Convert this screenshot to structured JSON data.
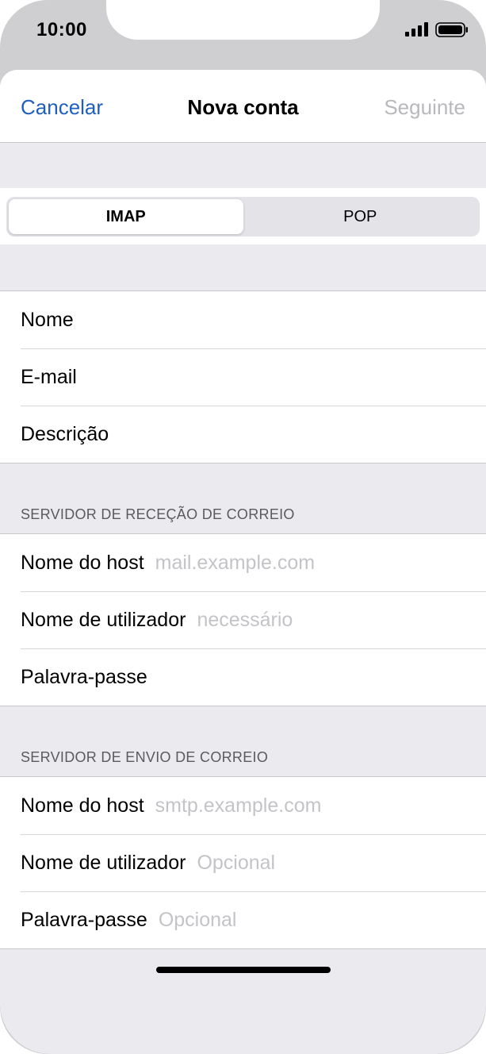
{
  "status_bar": {
    "time": "10:00",
    "signal_icon": "cellular-signal-icon",
    "battery_icon": "battery-full-icon"
  },
  "nav": {
    "cancel_label": "Cancelar",
    "title": "Nova conta",
    "next_label": "Seguinte"
  },
  "segments": [
    {
      "label": "IMAP",
      "selected": true
    },
    {
      "label": "POP",
      "selected": false
    }
  ],
  "account": {
    "name_label": "Nome",
    "email_label": "E-mail",
    "description_label": "Descrição"
  },
  "incoming": {
    "header": "SERVIDOR DE RECEÇÃO DE CORREIO",
    "host_label": "Nome do host",
    "host_placeholder": "mail.example.com",
    "user_label": "Nome de utilizador",
    "user_placeholder": "necessário",
    "password_label": "Palavra-passe"
  },
  "outgoing": {
    "header": "SERVIDOR DE ENVIO DE CORREIO",
    "host_label": "Nome do host",
    "host_placeholder": "smtp.example.com",
    "user_label": "Nome de utilizador",
    "user_placeholder": "Opcional",
    "password_label": "Palavra-passe",
    "password_placeholder": "Opcional"
  },
  "colors": {
    "accent": "#1f5fbf",
    "disabled": "#b8b8bd",
    "placeholder": "#c4c4c8",
    "grouped_background": "#eaeaef"
  }
}
